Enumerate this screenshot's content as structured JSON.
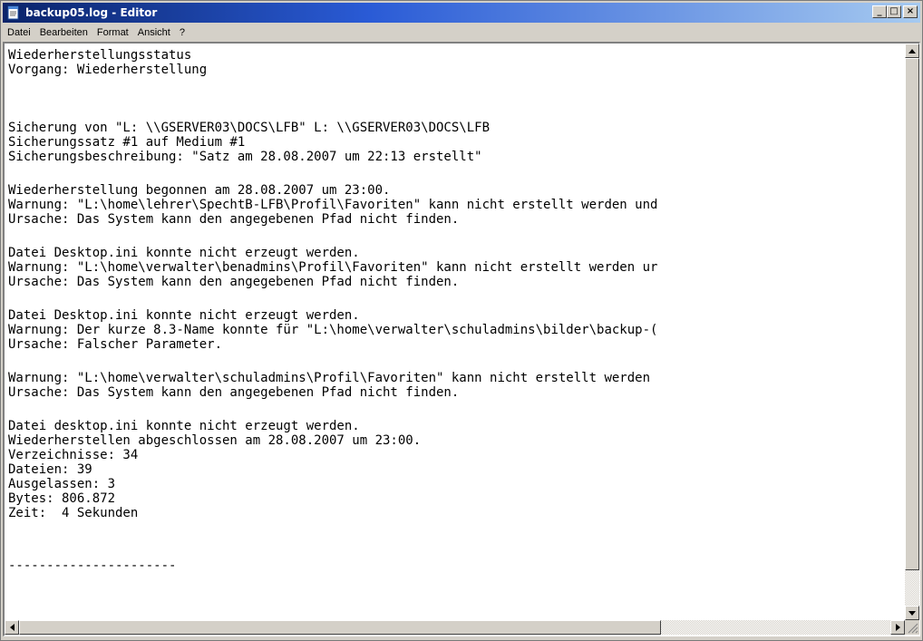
{
  "window": {
    "title": "backup05.log - Editor",
    "minimize_glyph": "_",
    "maximize_glyph": "□",
    "close_glyph": "×",
    "titlebar_color": "#0a246a"
  },
  "menu": {
    "items": [
      {
        "label": "Datei"
      },
      {
        "label": "Bearbeiten"
      },
      {
        "label": "Format"
      },
      {
        "label": "Ansicht"
      },
      {
        "label": "?"
      }
    ]
  },
  "document": {
    "lines": [
      "Wiederherstellungsstatus",
      "Vorgang: Wiederherstellung",
      "",
      "",
      "Sicherung von \"L: \\\\GSERVER03\\DOCS\\LFB\" L: \\\\GSERVER03\\DOCS\\LFB",
      "Sicherungssatz #1 auf Medium #1",
      "Sicherungsbeschreibung: \"Satz am 28.08.2007 um 22:13 erstellt\"",
      "",
      "Wiederherstellung begonnen am 28.08.2007 um 23:00.",
      "Warnung: \"L:\\home\\lehrer\\SpechtB-LFB\\Profil\\Favoriten\" kann nicht erstellt werden und",
      "Ursache: Das System kann den angegebenen Pfad nicht finden.",
      "",
      "Datei Desktop.ini konnte nicht erzeugt werden.",
      "Warnung: \"L:\\home\\verwalter\\benadmins\\Profil\\Favoriten\" kann nicht erstellt werden ur",
      "Ursache: Das System kann den angegebenen Pfad nicht finden.",
      "",
      "Datei Desktop.ini konnte nicht erzeugt werden.",
      "Warnung: Der kurze 8.3-Name konnte für \"L:\\home\\verwalter\\schuladmins\\bilder\\backup-(",
      "Ursache: Falscher Parameter.",
      "",
      "Warnung: \"L:\\home\\verwalter\\schuladmins\\Profil\\Favoriten\" kann nicht erstellt werden",
      "Ursache: Das System kann den angegebenen Pfad nicht finden.",
      "",
      "Datei desktop.ini konnte nicht erzeugt werden.",
      "Wiederherstellen abgeschlossen am 28.08.2007 um 23:00.",
      "Verzeichnisse: 34",
      "Dateien: 39",
      "Ausgelassen: 3",
      "Bytes: 806.872",
      "Zeit:  4 Sekunden",
      "",
      "",
      "----------------------"
    ]
  },
  "scrollbars": {
    "up_icon": "scroll-up-arrow",
    "down_icon": "scroll-down-arrow",
    "left_icon": "scroll-left-arrow",
    "right_icon": "scroll-right-arrow"
  }
}
